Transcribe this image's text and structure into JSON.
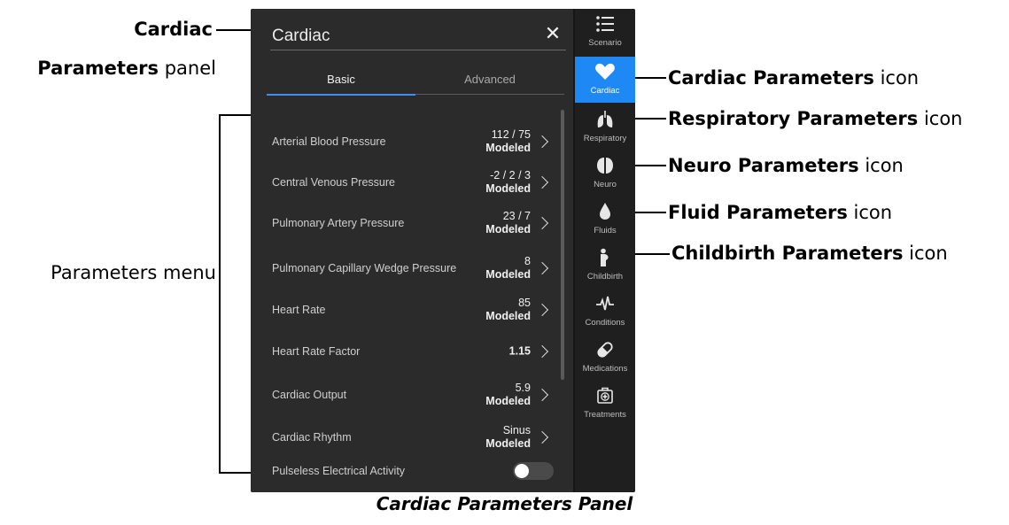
{
  "panel": {
    "title": "Cardiac",
    "close_symbol": "✕",
    "tabs": [
      {
        "label": "Basic",
        "active": true
      },
      {
        "label": "Advanced",
        "active": false
      }
    ],
    "parameters": [
      {
        "label": "Arterial Blood Pressure",
        "value": "112 / 75",
        "mode": "Modeled"
      },
      {
        "label": "Central Venous Pressure",
        "value": "-2 / 2 / 3",
        "mode": "Modeled"
      },
      {
        "label": "Pulmonary Artery Pressure",
        "value": "23 / 7",
        "mode": "Modeled"
      },
      {
        "label": "Pulmonary Capillary Wedge Pressure",
        "value": "8",
        "mode": "Modeled"
      },
      {
        "label": "Heart Rate",
        "value": "85",
        "mode": "Modeled"
      },
      {
        "label": "Heart Rate Factor",
        "value": "1.15",
        "mode": ""
      },
      {
        "label": "Cardiac Output",
        "value": "5.9",
        "mode": "Modeled"
      },
      {
        "label": "Cardiac Rhythm",
        "value": "Sinus",
        "mode": "Modeled"
      }
    ],
    "toggle_param": {
      "label": "Pulseless Electrical Activity",
      "on": false
    }
  },
  "sidebar": {
    "items": [
      {
        "label": "Scenario",
        "icon": "list-icon",
        "active": false
      },
      {
        "label": "Cardiac",
        "icon": "heart-icon",
        "active": true
      },
      {
        "label": "Respiratory",
        "icon": "lungs-icon",
        "active": false
      },
      {
        "label": "Neuro",
        "icon": "brain-icon",
        "active": false
      },
      {
        "label": "Fluids",
        "icon": "drop-icon",
        "active": false
      },
      {
        "label": "Childbirth",
        "icon": "pregnant-icon",
        "active": false
      },
      {
        "label": "Conditions",
        "icon": "pulse-icon",
        "active": false
      },
      {
        "label": "Medications",
        "icon": "pill-icon",
        "active": false
      },
      {
        "label": "Treatments",
        "icon": "first-aid-icon",
        "active": false
      }
    ]
  },
  "annotations": {
    "cardiac_panel": {
      "bold": "Cardiac",
      "bold2": "Parameters",
      "rest": " panel"
    },
    "parameters_menu": "Parameters menu",
    "cardiac_icon": {
      "bold": "Cardiac Parameters",
      "rest": " icon"
    },
    "respiratory_icon": {
      "bold": "Respiratory Parameters",
      "rest": " icon"
    },
    "neuro_icon": {
      "bold": "Neuro Parameters",
      "rest": " icon"
    },
    "fluid_icon": {
      "bold": "Fluid Parameters",
      "rest": " icon"
    },
    "childbirth_icon": {
      "bold": "Childbirth Parameters",
      "rest": " icon"
    },
    "caption": "Cardiac Parameters Panel"
  },
  "colors": {
    "accent": "#1e88f5",
    "panel_bg": "#2b2b2b",
    "sidebar_bg": "#1f1f1f"
  }
}
